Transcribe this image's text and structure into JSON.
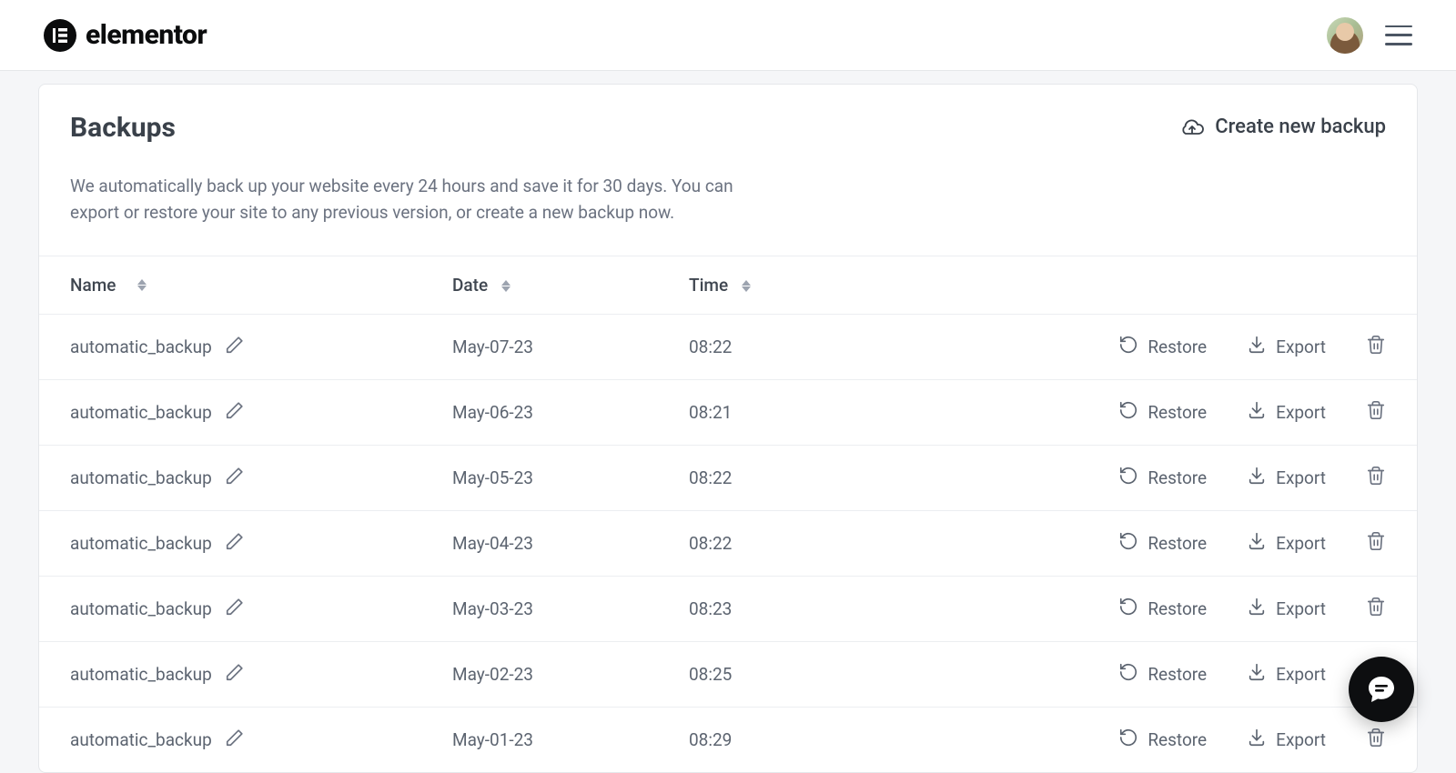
{
  "header": {
    "brand": "elementor",
    "logo_letter": "E"
  },
  "page": {
    "title": "Backups",
    "description": "We automatically back up your website every 24 hours and save it for 30 days. You can export or restore your site to any previous version, or create a new backup now.",
    "create_label": "Create new backup"
  },
  "columns": {
    "name": "Name",
    "date": "Date",
    "time": "Time"
  },
  "row_actions": {
    "restore": "Restore",
    "export": "Export"
  },
  "rows": [
    {
      "name": "automatic_backup",
      "date": "May-07-23",
      "time": "08:22"
    },
    {
      "name": "automatic_backup",
      "date": "May-06-23",
      "time": "08:21"
    },
    {
      "name": "automatic_backup",
      "date": "May-05-23",
      "time": "08:22"
    },
    {
      "name": "automatic_backup",
      "date": "May-04-23",
      "time": "08:22"
    },
    {
      "name": "automatic_backup",
      "date": "May-03-23",
      "time": "08:23"
    },
    {
      "name": "automatic_backup",
      "date": "May-02-23",
      "time": "08:25"
    },
    {
      "name": "automatic_backup",
      "date": "May-01-23",
      "time": "08:29"
    }
  ]
}
